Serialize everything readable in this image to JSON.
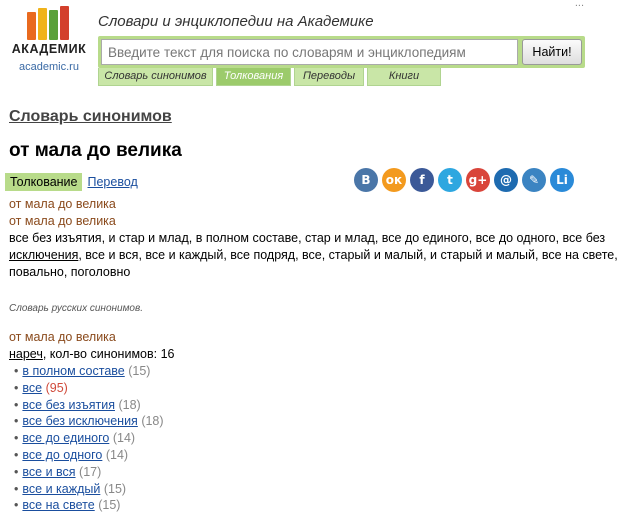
{
  "header": {
    "logo_name": "АКАДЕМИК",
    "logo_url": "academic.ru",
    "site_title": "Словари и энциклопедии на Академике",
    "top_links": "...",
    "search_placeholder": "Введите текст для поиска по словарям и энциклопедиям",
    "search_button": "Найти!",
    "tabs": [
      {
        "label": "Словарь синонимов",
        "active": false
      },
      {
        "label": "Толкования",
        "active": true
      },
      {
        "label": "Переводы",
        "active": false
      },
      {
        "label": "Книги",
        "active": false
      }
    ]
  },
  "article": {
    "dictionary_title": "Словарь синонимов",
    "headword": "от мала до велика",
    "view_tabs": {
      "active": "Толкование",
      "link": "Перевод"
    },
    "share": [
      {
        "name": "vk-icon",
        "glyph": "В",
        "color": "#4a76a8"
      },
      {
        "name": "odnoklassniki-icon",
        "glyph": "ок",
        "color": "#f39a1e"
      },
      {
        "name": "facebook-icon",
        "glyph": "f",
        "color": "#3b5998"
      },
      {
        "name": "twitter-icon",
        "glyph": "t",
        "color": "#2ea7e0"
      },
      {
        "name": "google-plus-icon",
        "glyph": "g+",
        "color": "#d9453a"
      },
      {
        "name": "mail-ru-icon",
        "glyph": "@",
        "color": "#1e6bb0"
      },
      {
        "name": "livejournal-icon",
        "glyph": "✎",
        "color": "#3b84c2"
      },
      {
        "name": "liveinternet-icon",
        "glyph": "Li",
        "color": "#2a8ad8"
      }
    ],
    "entry1": {
      "term1": "от мала до велика",
      "term2": "от мала до велика",
      "def_part1": "все без изъятия, и стар и млад, в полном составе, стар и млад, все до единого, все до одного, все без ",
      "def_link": "исключения",
      "def_part2": ", все и вся, все и каждый, все подряд, все, старый и малый, и старый и малый, все на свете, повально, поголовно"
    },
    "source": "Словарь русских синонимов.",
    "entry2": {
      "term": "от мала до велика",
      "pos": "нареч",
      "count_text": ", кол-во синонимов: 16",
      "synonyms": [
        {
          "word": "в полном составе",
          "count": "(15)",
          "hot": false
        },
        {
          "word": "все",
          "count": "(95)",
          "hot": true
        },
        {
          "word": "все без изъятия",
          "count": "(18)",
          "hot": false
        },
        {
          "word": "все без исключения",
          "count": "(18)",
          "hot": false
        },
        {
          "word": "все до единого",
          "count": "(14)",
          "hot": false
        },
        {
          "word": "все до одного",
          "count": "(14)",
          "hot": false
        },
        {
          "word": "все и вся",
          "count": "(17)",
          "hot": false
        },
        {
          "word": "все и каждый",
          "count": "(15)",
          "hot": false
        },
        {
          "word": "все на свете",
          "count": "(15)",
          "hot": false
        }
      ]
    }
  },
  "colors": {
    "brand_green": "#b8db8a",
    "link_blue": "#1a4e9e",
    "term_brown": "#8a4a1c"
  }
}
